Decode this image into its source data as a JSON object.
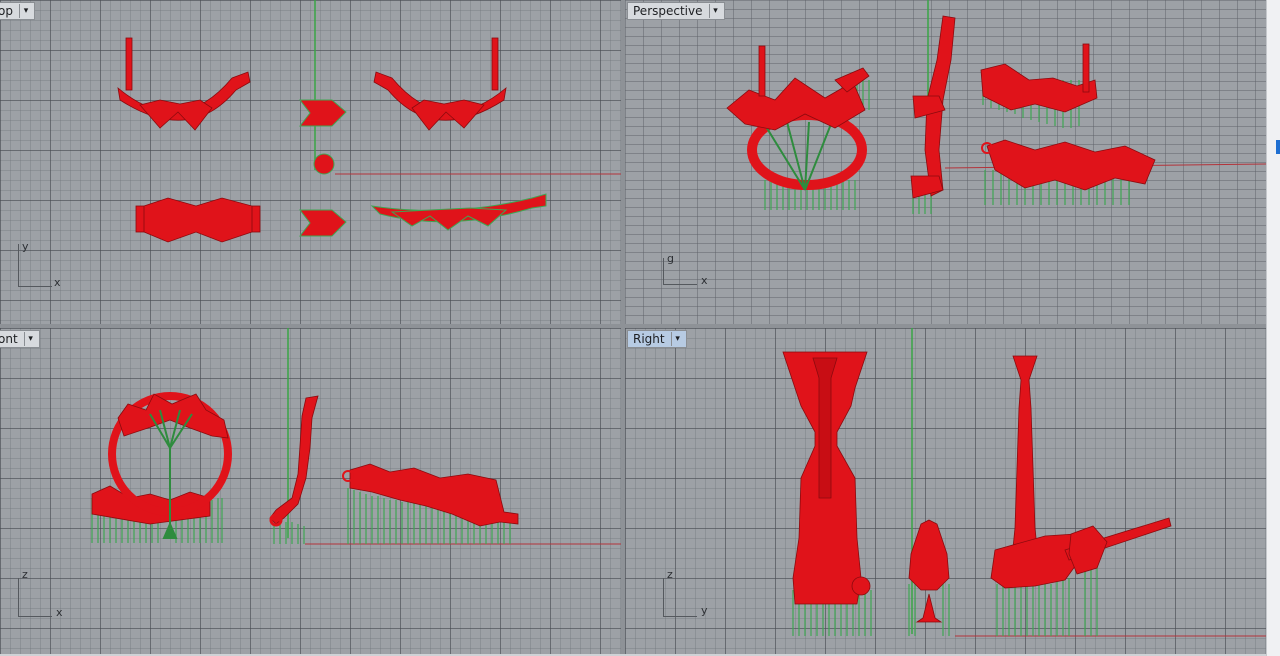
{
  "viewports": {
    "top": {
      "label": "op",
      "axis_vertical": "y",
      "axis_horizontal": "x"
    },
    "perspective": {
      "label": "Perspective",
      "axis_vertical": "g",
      "axis_horizontal": "x"
    },
    "front": {
      "label": "ont",
      "axis_vertical": "z",
      "axis_horizontal": "x"
    },
    "right": {
      "label": "Right",
      "axis_vertical": "z",
      "axis_horizontal": "y"
    }
  },
  "menu_arrow": "▾",
  "colors": {
    "part_red": "#e0131a",
    "support_green": "#3fa653",
    "axis_green": "#3aa546",
    "axis_red": "#b3333a",
    "active_tab": "#b7cbe3"
  }
}
